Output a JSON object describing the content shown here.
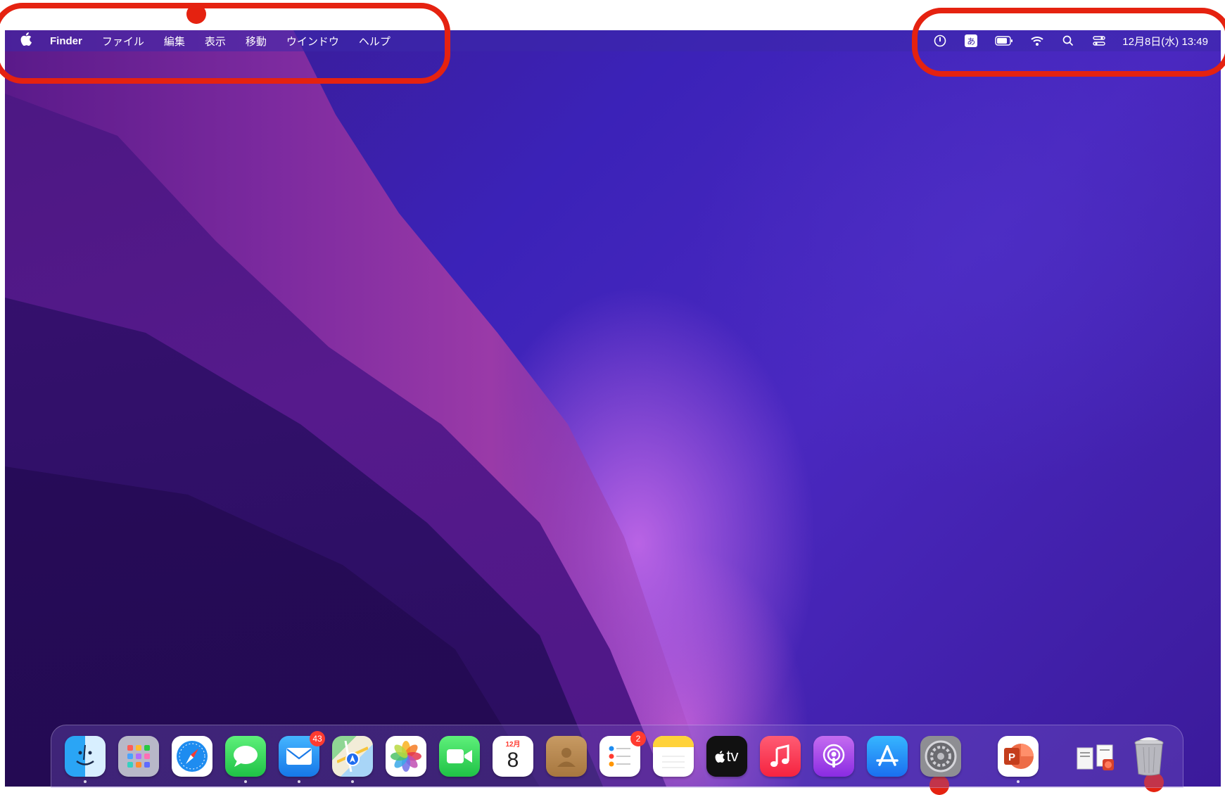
{
  "menubar": {
    "apple_glyph": "",
    "app_name": "Finder",
    "menus": [
      "ファイル",
      "編集",
      "表示",
      "移動",
      "ウインドウ",
      "ヘルプ"
    ],
    "status_icons": [
      "power-icon",
      "input-method-icon",
      "battery-icon",
      "wifi-icon",
      "spotlight-icon",
      "control-center-icon"
    ],
    "input_method_glyph": "あ",
    "clock": "12月8日(水) 13:49"
  },
  "dock": {
    "apps": [
      {
        "name": "Finder",
        "icon": "finder-icon",
        "running": true
      },
      {
        "name": "Launchpad",
        "icon": "launchpad-icon",
        "running": false
      },
      {
        "name": "Safari",
        "icon": "safari-icon",
        "running": false
      },
      {
        "name": "メッセージ",
        "icon": "messages-icon",
        "running": true
      },
      {
        "name": "メール",
        "icon": "mail-icon",
        "badge": "43",
        "running": true
      },
      {
        "name": "マップ",
        "icon": "maps-icon",
        "running": true
      },
      {
        "name": "写真",
        "icon": "photos-icon",
        "running": false
      },
      {
        "name": "FaceTime",
        "icon": "facetime-icon",
        "running": false
      },
      {
        "name": "カレンダー",
        "icon": "calendar-icon",
        "month": "12月",
        "day": "8",
        "running": false
      },
      {
        "name": "連絡先",
        "icon": "contacts-icon",
        "running": false
      },
      {
        "name": "リマインダー",
        "icon": "reminders-icon",
        "badge": "2",
        "running": false
      },
      {
        "name": "メモ",
        "icon": "notes-icon",
        "running": true
      },
      {
        "name": "TV",
        "icon": "apple-tv-icon",
        "label": "tv",
        "running": false
      },
      {
        "name": "ミュージック",
        "icon": "music-icon",
        "running": false
      },
      {
        "name": "Podcast",
        "icon": "podcasts-icon",
        "running": false
      },
      {
        "name": "App Store",
        "icon": "app-store-icon",
        "running": false
      },
      {
        "name": "システム環境設定",
        "icon": "system-preferences-icon",
        "running": false
      },
      {
        "name": "PowerPoint",
        "icon": "powerpoint-icon",
        "letter": "P",
        "running": true
      },
      {
        "name": "ダウンロード",
        "icon": "downloads-stack-icon",
        "running": false
      },
      {
        "name": "ゴミ箱",
        "icon": "trash-icon",
        "running": false
      }
    ]
  },
  "colors": {
    "annotation": "#e52210",
    "badge": "#ff3b30"
  }
}
